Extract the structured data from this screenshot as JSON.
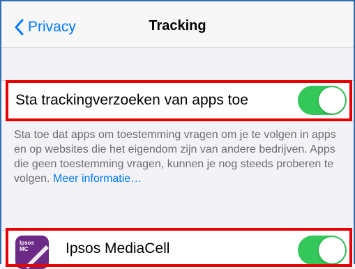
{
  "nav": {
    "back_label": "Privacy",
    "title": "Tracking"
  },
  "tracking_toggle": {
    "label": "Sta trackingverzoeken van apps toe",
    "state": "on"
  },
  "footer": {
    "text": "Sta toe dat apps om toestemming vragen om je te volgen in apps en op websites die het eigendom zijn van andere bedrijven. Apps die geen toestemming vragen, kunnen je nog steeds proberen te volgen. ",
    "link": "Meer informatie…"
  },
  "apps": [
    {
      "name": "Ipsos MediaCell",
      "icon_text_1": "Ipsos",
      "icon_text_2": "MC",
      "state": "on"
    }
  ],
  "colors": {
    "accent": "#007aff",
    "switch_on": "#34c759",
    "highlight": "#e60000",
    "app_icon_bg": "#6b2a86"
  },
  "icons": {
    "back": "chevron-left-icon"
  }
}
